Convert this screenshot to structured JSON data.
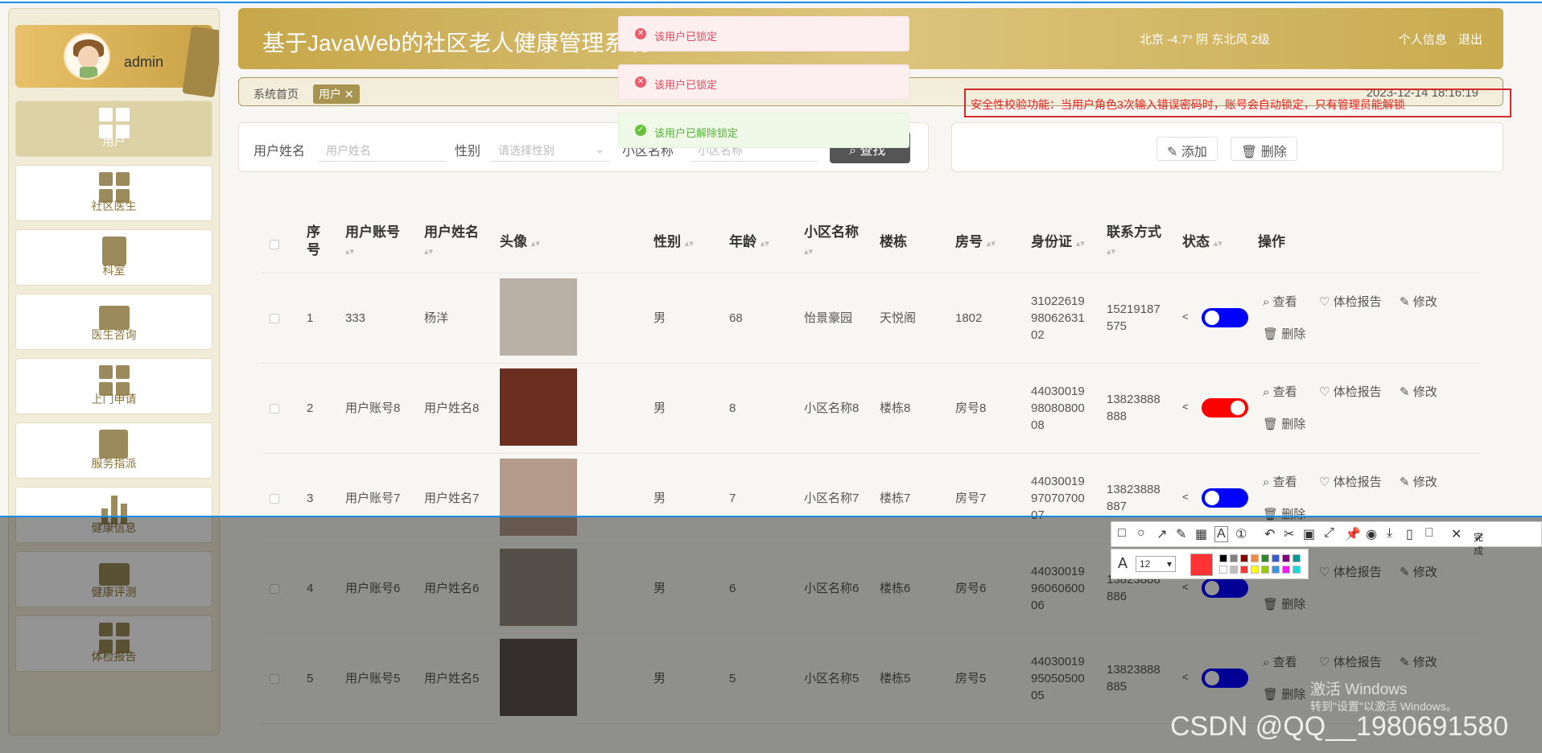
{
  "sidebar": {
    "username": "admin",
    "items": [
      {
        "label": "用户",
        "icon": "grid-icon"
      },
      {
        "label": "社区医生",
        "icon": "grid-icon"
      },
      {
        "label": "科室",
        "icon": "clipboard-icon"
      },
      {
        "label": "医生咨询",
        "icon": "briefcase-icon"
      },
      {
        "label": "上门申请",
        "icon": "grid-icon"
      },
      {
        "label": "服务指派",
        "icon": "book-icon"
      },
      {
        "label": "健康信息",
        "icon": "bar-chart-icon"
      },
      {
        "label": "健康评测",
        "icon": "wallet-icon"
      },
      {
        "label": "体检报告",
        "icon": "grid-icon"
      }
    ]
  },
  "header": {
    "title": "基于JavaWeb的社区老人健康管理系统",
    "weather": "北京  -4.7°  阴  东北风  2级",
    "profile": "个人信息",
    "logout": "退出"
  },
  "breadcrumb": {
    "home": "系统首页",
    "tag": "用户",
    "datetime": "2023-12-14 18:16:19"
  },
  "search": {
    "name_label": "用户姓名",
    "name_placeholder": "用户姓名",
    "gender_label": "性别",
    "gender_placeholder": "请选择性别",
    "community_label": "小区名称",
    "community_placeholder": "小区名称",
    "button": "查找"
  },
  "actions": {
    "add": "添加",
    "delete": "删除"
  },
  "toasts": [
    {
      "type": "error",
      "text": "该用户已锁定"
    },
    {
      "type": "error",
      "text": "该用户已锁定"
    },
    {
      "type": "success",
      "text": "该用户已解除锁定"
    }
  ],
  "annotation": "安全性校验功能：当用户角色3次输入错误密码时，账号会自动锁定，只有管理员能解锁",
  "table": {
    "headers": [
      "序号",
      "用户账号",
      "用户姓名",
      "头像",
      "性别",
      "年龄",
      "小区名称",
      "楼栋",
      "房号",
      "身份证",
      "联系方式",
      "状态",
      "操作"
    ],
    "ops": {
      "view": "查看",
      "report": "体检报告",
      "edit": "修改",
      "delete": "删除"
    },
    "rows": [
      {
        "no": "1",
        "account": "333",
        "name": "杨洋",
        "gender": "男",
        "age": "68",
        "community": "怡景豪园",
        "building": "天悦阁",
        "room": "1802",
        "id_l1": "31022619",
        "id_l2": "98062631",
        "id_l3": "02",
        "phone_l1": "15219187",
        "phone_l2": "575",
        "status": "on"
      },
      {
        "no": "2",
        "account": "用户账号8",
        "name": "用户姓名8",
        "gender": "男",
        "age": "8",
        "community": "小区名称8",
        "building": "楼栋8",
        "room": "房号8",
        "id_l1": "44030019",
        "id_l2": "98080800",
        "id_l3": "08",
        "phone_l1": "13823888",
        "phone_l2": "888",
        "status": "off"
      },
      {
        "no": "3",
        "account": "用户账号7",
        "name": "用户姓名7",
        "gender": "男",
        "age": "7",
        "community": "小区名称7",
        "building": "楼栋7",
        "room": "房号7",
        "id_l1": "44030019",
        "id_l2": "97070700",
        "id_l3": "07",
        "phone_l1": "13823888",
        "phone_l2": "887",
        "status": "on"
      },
      {
        "no": "4",
        "account": "用户账号6",
        "name": "用户姓名6",
        "gender": "男",
        "age": "6",
        "community": "小区名称6",
        "building": "楼栋6",
        "room": "房号6",
        "id_l1": "44030019",
        "id_l2": "96060600",
        "id_l3": "06",
        "phone_l1": "13823888",
        "phone_l2": "886",
        "status": "on"
      },
      {
        "no": "5",
        "account": "用户账号5",
        "name": "用户姓名5",
        "gender": "男",
        "age": "5",
        "community": "小区名称5",
        "building": "楼栋5",
        "room": "房号5",
        "id_l1": "44030019",
        "id_l2": "95050500",
        "id_l3": "05",
        "phone_l1": "13823888",
        "phone_l2": "885",
        "status": "on"
      }
    ]
  },
  "capture_toolbar": {
    "done": "完成",
    "font_size": "12",
    "current_color": "#ff3333"
  },
  "watermarks": {
    "activate": "激活 Windows",
    "activate_sub": "转到\"设置\"以激活 Windows。",
    "csdn": "CSDN @QQ__1980691580"
  }
}
